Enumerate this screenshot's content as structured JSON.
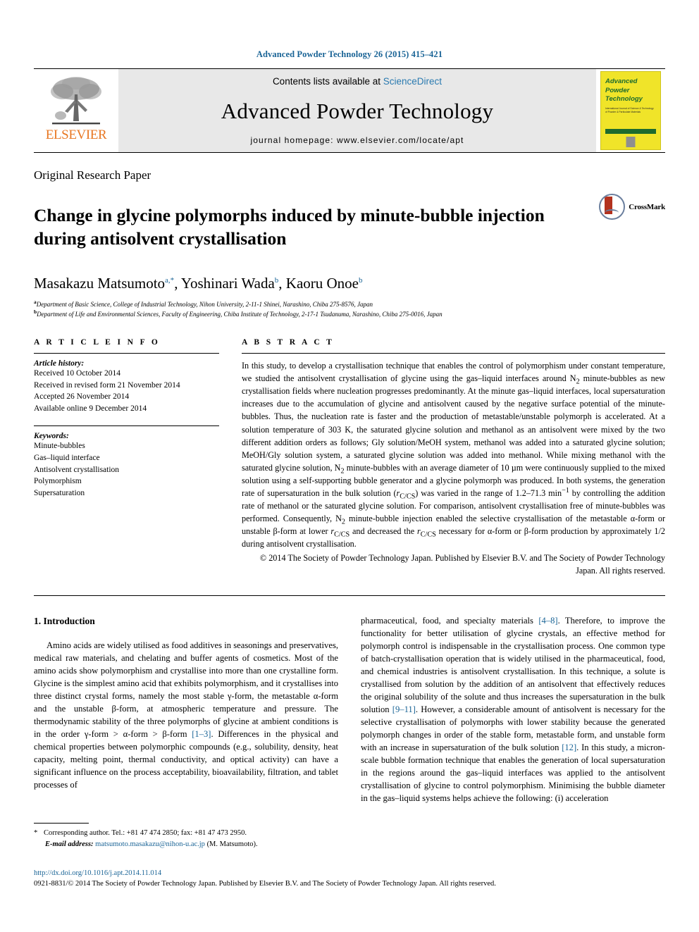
{
  "running_head": "Advanced Powder Technology 26 (2015) 415–421",
  "masthead": {
    "elsevier_logo_word": "ELSEVIER",
    "contents_prefix": "Contents lists available at ",
    "contents_link": "ScienceDirect",
    "journal_name": "Advanced Powder Technology",
    "homepage_text": "journal homepage: www.elsevier.com/locate/apt",
    "cover": {
      "line1": "Advanced",
      "line2": "Powder",
      "line3": "Technology",
      "subtitle": "International Journal of Science & Technology of Powder & Particulate Materials"
    }
  },
  "article": {
    "type": "Original Research Paper",
    "title": "Change in glycine polymorphs induced by minute-bubble injection during antisolvent crystallisation",
    "crossmark_label": "CrossMark",
    "authors_html": "Masakazu Matsumoto<sup>a,*</sup>, Yoshinari Wada<sup>b</sup>, Kaoru Onoe<sup>b</sup>",
    "affiliation_a": "Department of Basic Science, College of Industrial Technology, Nihon University, 2-11-1 Shinei, Narashino, Chiba 275-8576, Japan",
    "affiliation_b": "Department of Life and Environmental Sciences, Faculty of Engineering, Chiba Institute of Technology, 2-17-1 Tsudanuma, Narashino, Chiba 275-0016, Japan"
  },
  "article_info": {
    "heading": "A R T I C L E   I N F O",
    "history_label": "Article history:",
    "history": [
      "Received 10 October 2014",
      "Received in revised form 21 November 2014",
      "Accepted 26 November 2014",
      "Available online 9 December 2014"
    ],
    "keywords_label": "Keywords:",
    "keywords": [
      "Minute-bubbles",
      "Gas–liquid interface",
      "Antisolvent crystallisation",
      "Polymorphism",
      "Supersaturation"
    ]
  },
  "abstract": {
    "heading": "A B S T R A C T",
    "body_html": "In this study, to develop a crystallisation technique that enables the control of polymorphism under constant temperature, we studied the antisolvent crystallisation of glycine using the gas–liquid interfaces around N<sub>2</sub> minute-bubbles as new crystallisation fields where nucleation progresses predominantly. At the minute gas–liquid interfaces, local supersaturation increases due to the accumulation of glycine and antisolvent caused by the negative surface potential of the minute-bubbles. Thus, the nucleation rate is faster and the production of metastable/unstable polymorph is accelerated. At a solution temperature of 303 K, the saturated glycine solution and methanol as an antisolvent were mixed by the two different addition orders as follows; Gly solution/MeOH system, methanol was added into a saturated glycine solution; MeOH/Gly solution system, a saturated glycine solution was added into methanol. While mixing methanol with the saturated glycine solution, N<sub>2</sub> minute-bubbles with an average diameter of 10 µm were continuously supplied to the mixed solution using a self-supporting bubble generator and a glycine polymorph was produced. In both systems, the generation rate of supersaturation in the bulk solution (<i>r</i><sub>C/CS</sub>) was varied in the range of 1.2–71.3 min<sup>−1</sup> by controlling the addition rate of methanol or the saturated glycine solution. For comparison, antisolvent crystallisation free of minute-bubbles was performed. Consequently, N<sub>2</sub> minute-bubble injection enabled the selective crystallisation of the metastable α-form or unstable β-form at lower <i>r</i><sub>C/CS</sub> and decreased the <i>r</i><sub>C/CS</sub> necessary for α-form or β-form production by approximately 1/2 during antisolvent crystallisation.",
    "copyright_html": "© 2014 The Society of Powder Technology Japan. Published by Elsevier B.V. and The Society of Powder Technology Japan. All rights reserved."
  },
  "introduction": {
    "heading": "1. Introduction",
    "left_html": "Amino acids are widely utilised as food additives in seasonings and preservatives, medical raw materials, and chelating and buffer agents of cosmetics. Most of the amino acids show polymorphism and crystallise into more than one crystalline form. Glycine is the simplest amino acid that exhibits polymorphism, and it crystallises into three distinct crystal forms, namely the most stable γ-form, the metastable α-form and the unstable β-form, at atmospheric temperature and pressure. The thermodynamic stability of the three polymorphs of glycine at ambient conditions is in the order γ-form &gt; α-form &gt; β-form <span class=\"ref\">[1–3]</span>. Differences in the physical and chemical properties between polymorphic compounds (e.g., solubility, density, heat capacity, melting point, thermal conductivity, and optical activity) can have a significant influence on the process acceptability, bioavailability, filtration, and tablet processes of",
    "right_html": "pharmaceutical, food, and specialty materials <span class=\"ref\">[4–8]</span>. Therefore, to improve the functionality for better utilisation of glycine crystals, an effective method for polymorph control is indispensable in the crystallisation process. One common type of batch-crystallisation operation that is widely utilised in the pharmaceutical, food, and chemical industries is antisolvent crystallisation. In this technique, a solute is crystallised from solution by the addition of an antisolvent that effectively reduces the original solubility of the solute and thus increases the supersaturation in the bulk solution <span class=\"ref\">[9–11]</span>. However, a considerable amount of antisolvent is necessary for the selective crystallisation of polymorphs with lower stability because the generated polymorph changes in order of the stable form, metastable form, and unstable form with an increase in supersaturation of the bulk solution <span class=\"ref\">[12]</span>. In this study, a micron-scale bubble formation technique that enables the generation of local supersaturation in the regions around the gas–liquid interfaces was applied to the antisolvent crystallisation of glycine to control polymorphism. Minimising the bubble diameter in the gas–liquid systems helps achieve the following: (i) acceleration"
  },
  "footnote": {
    "star": "*",
    "corresponding_html": "Corresponding author. Tel.: +81 47 474 2850; fax: +81 47 473 2950.",
    "email_label": "E-mail address:",
    "email": "matsumoto.masakazu@nihon-u.ac.jp",
    "email_owner": "(M. Matsumoto)."
  },
  "footer": {
    "doi": "http://dx.doi.org/10.1016/j.apt.2014.11.014",
    "issn_line": "0921-8831/© 2014 The Society of Powder Technology Japan. Published by Elsevier B.V. and The Society of Powder Technology Japan. All rights reserved."
  },
  "colors": {
    "link_blue": "#1a6496",
    "sciencedirect_blue": "#2a7ab0",
    "elsevier_orange": "#E87722",
    "cover_yellow": "#f0e429",
    "cover_green": "#1d6b2e",
    "masthead_grey": "#e8e8e8"
  }
}
